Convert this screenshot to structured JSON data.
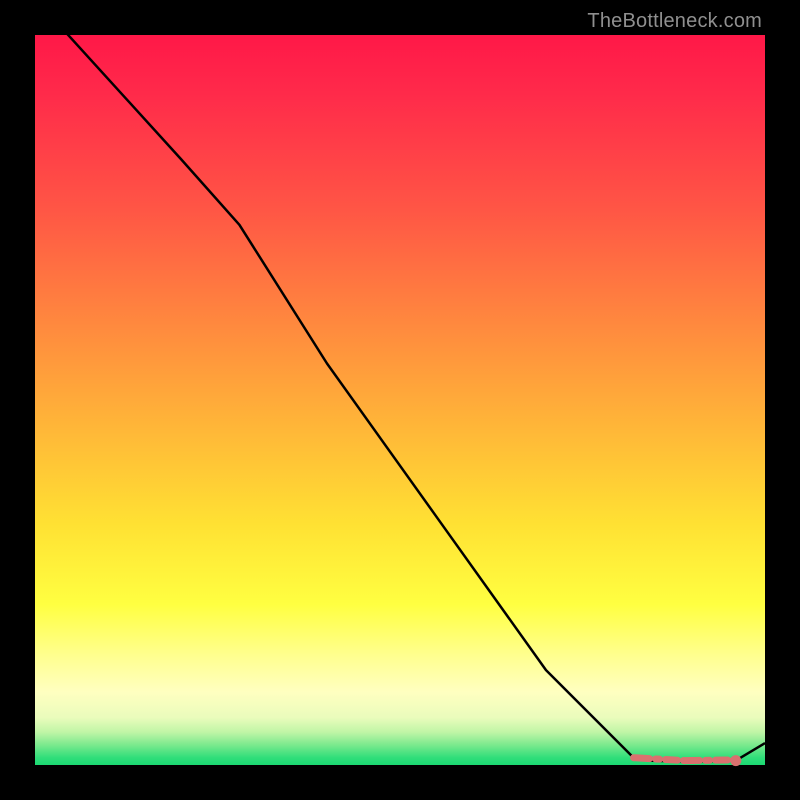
{
  "watermark": "TheBottleneck.com",
  "chart_data": {
    "type": "line",
    "title": "",
    "xlabel": "",
    "ylabel": "",
    "xlim": [
      0,
      100
    ],
    "ylim": [
      0,
      100
    ],
    "series": [
      {
        "name": "curve",
        "x": [
          0,
          10,
          20,
          28,
          40,
          55,
          70,
          82,
          84,
          88,
          92,
          96,
          100
        ],
        "y": [
          105,
          94,
          83,
          74,
          55,
          34,
          13,
          1,
          0.6,
          0.5,
          0.5,
          0.6,
          3
        ]
      }
    ],
    "flat_region": {
      "x_start": 82,
      "x_end": 96,
      "y": 0.6,
      "color": "#d9716f",
      "end_dot_x": 96,
      "end_dot_y": 0.6
    }
  },
  "colors": {
    "curve": "#000000",
    "flat_highlight": "#d9716f",
    "background_black": "#000000",
    "watermark": "#8f8f8f"
  }
}
